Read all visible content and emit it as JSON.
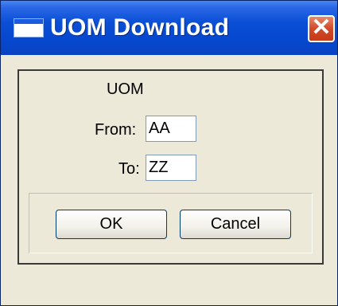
{
  "window": {
    "title": "UOM Download",
    "close_glyph": "✕"
  },
  "form": {
    "heading": "UOM",
    "from_label": "From:",
    "from_value": "AA",
    "to_label": "To:",
    "to_value": "ZZ"
  },
  "buttons": {
    "ok": "OK",
    "cancel": "Cancel"
  },
  "colors": {
    "titlebar": "#0a4fd6",
    "close": "#d24a2a",
    "face": "#ece9d8"
  }
}
